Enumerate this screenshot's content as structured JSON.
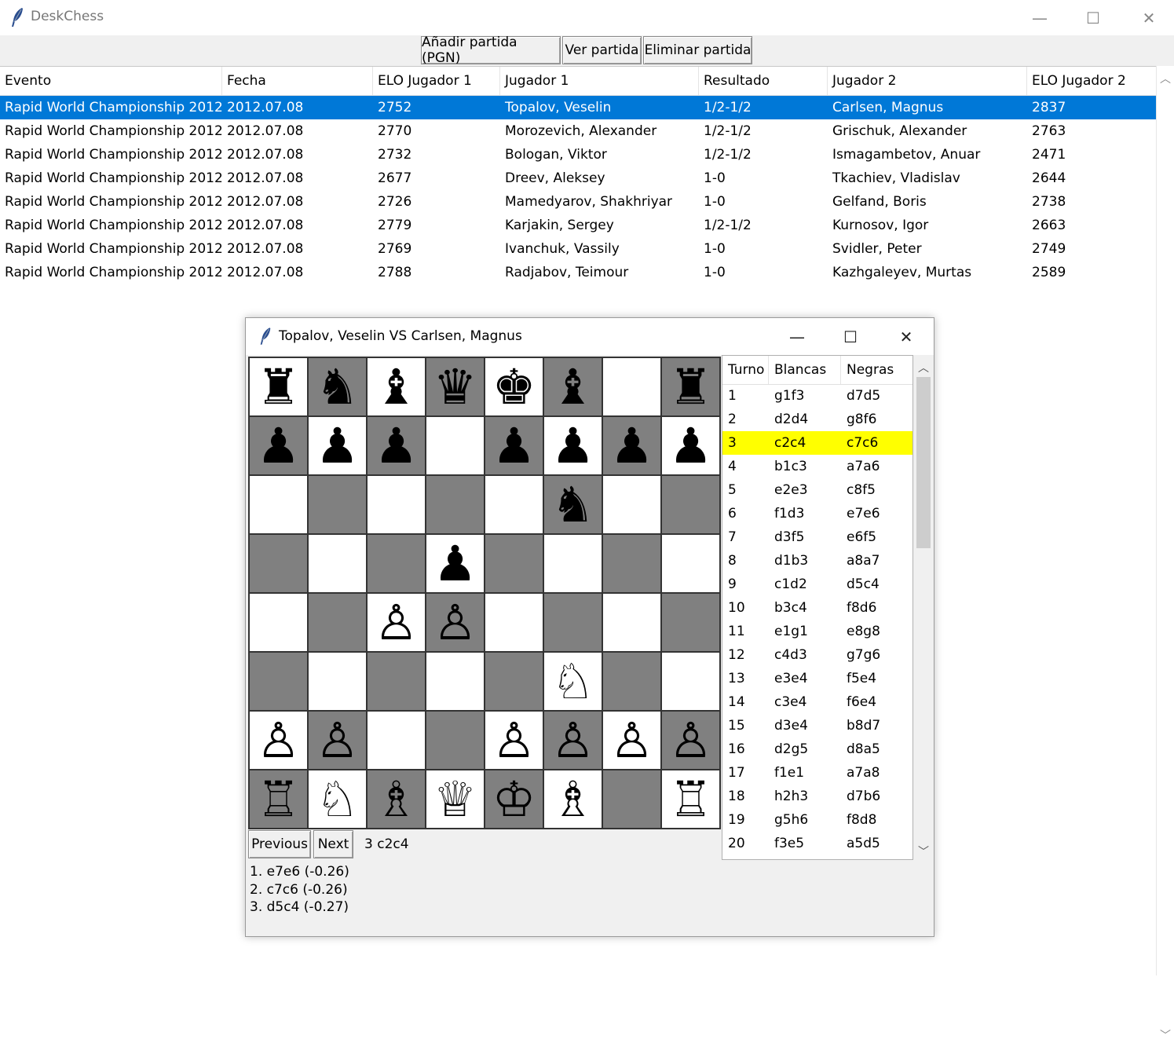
{
  "app": {
    "title": "DeskChess"
  },
  "toolbar": {
    "add_label": "Añadir partida (PGN)",
    "view_label": "Ver partida",
    "delete_label": "Eliminar partida"
  },
  "games_table": {
    "columns": [
      "Evento",
      "Fecha",
      "ELO Jugador 1",
      "Jugador 1",
      "Resultado",
      "Jugador 2",
      "ELO Jugador 2"
    ],
    "rows": [
      [
        "Rapid World Championship 2012",
        "2012.07.08",
        "2752",
        "Topalov, Veselin",
        "1/2-1/2",
        "Carlsen, Magnus",
        "2837"
      ],
      [
        "Rapid World Championship 2012",
        "2012.07.08",
        "2770",
        "Morozevich, Alexander",
        "1/2-1/2",
        "Grischuk, Alexander",
        "2763"
      ],
      [
        "Rapid World Championship 2012",
        "2012.07.08",
        "2732",
        "Bologan, Viktor",
        "1/2-1/2",
        "Ismagambetov, Anuar",
        "2471"
      ],
      [
        "Rapid World Championship 2012",
        "2012.07.08",
        "2677",
        "Dreev, Aleksey",
        "1-0",
        "Tkachiev, Vladislav",
        "2644"
      ],
      [
        "Rapid World Championship 2012",
        "2012.07.08",
        "2726",
        "Mamedyarov, Shakhriyar",
        "1-0",
        "Gelfand, Boris",
        "2738"
      ],
      [
        "Rapid World Championship 2012",
        "2012.07.08",
        "2779",
        "Karjakin, Sergey",
        "1/2-1/2",
        "Kurnosov, Igor",
        "2663"
      ],
      [
        "Rapid World Championship 2012",
        "2012.07.08",
        "2769",
        "Ivanchuk, Vassily",
        "1-0",
        "Svidler, Peter",
        "2749"
      ],
      [
        "Rapid World Championship 2012",
        "2012.07.08",
        "2788",
        "Radjabov, Teimour",
        "1-0",
        "Kazhgaleyev, Murtas",
        "2589"
      ]
    ],
    "selected_row": 0
  },
  "game_window": {
    "title": "Topalov, Veselin VS Carlsen, Magnus",
    "board": [
      [
        "♜",
        "♞",
        "♝",
        "♛",
        "♚",
        "♝",
        "",
        "♜"
      ],
      [
        "♟",
        "♟",
        "♟",
        "",
        "♟",
        "♟",
        "♟",
        "♟"
      ],
      [
        "",
        "",
        "",
        "",
        "",
        "♞",
        "",
        ""
      ],
      [
        "",
        "",
        "",
        "♟",
        "",
        "",
        "",
        ""
      ],
      [
        "",
        "",
        "♙",
        "♙",
        "",
        "",
        "",
        ""
      ],
      [
        "",
        "",
        "",
        "",
        "",
        "♘",
        "",
        ""
      ],
      [
        "♙",
        "♙",
        "",
        "",
        "♙",
        "♙",
        "♙",
        "♙"
      ],
      [
        "♖",
        "♘",
        "♗",
        "♕",
        "♔",
        "♗",
        "",
        "♖"
      ]
    ],
    "previous_label": "Previous",
    "next_label": "Next",
    "current_move": "3 c2c4",
    "engine_lines": [
      "1. e7e6 (-0.26)",
      "2. c7c6 (-0.26)",
      "3. d5c4 (-0.27)"
    ],
    "moves_columns": [
      "Turno",
      "Blancas",
      "Negras"
    ],
    "moves": [
      [
        "1",
        "g1f3",
        "d7d5"
      ],
      [
        "2",
        "d2d4",
        "g8f6"
      ],
      [
        "3",
        "c2c4",
        "c7c6"
      ],
      [
        "4",
        "b1c3",
        "a7a6"
      ],
      [
        "5",
        "e2e3",
        "c8f5"
      ],
      [
        "6",
        "f1d3",
        "e7e6"
      ],
      [
        "7",
        "d3f5",
        "e6f5"
      ],
      [
        "8",
        "d1b3",
        "a8a7"
      ],
      [
        "9",
        "c1d2",
        "d5c4"
      ],
      [
        "10",
        "b3c4",
        "f8d6"
      ],
      [
        "11",
        "e1g1",
        "e8g8"
      ],
      [
        "12",
        "c4d3",
        "g7g6"
      ],
      [
        "13",
        "e3e4",
        "f5e4"
      ],
      [
        "14",
        "c3e4",
        "f6e4"
      ],
      [
        "15",
        "d3e4",
        "b8d7"
      ],
      [
        "16",
        "d2g5",
        "d8a5"
      ],
      [
        "17",
        "f1e1",
        "a7a8"
      ],
      [
        "18",
        "h2h3",
        "d7b6"
      ],
      [
        "19",
        "g5h6",
        "f8d8"
      ],
      [
        "20",
        "f3e5",
        "a5d5"
      ]
    ],
    "highlighted_move": 2
  },
  "colors": {
    "selection": "#0078d7",
    "highlight": "#ffff00",
    "dark_square": "#808080",
    "light_square": "#ffffff"
  }
}
